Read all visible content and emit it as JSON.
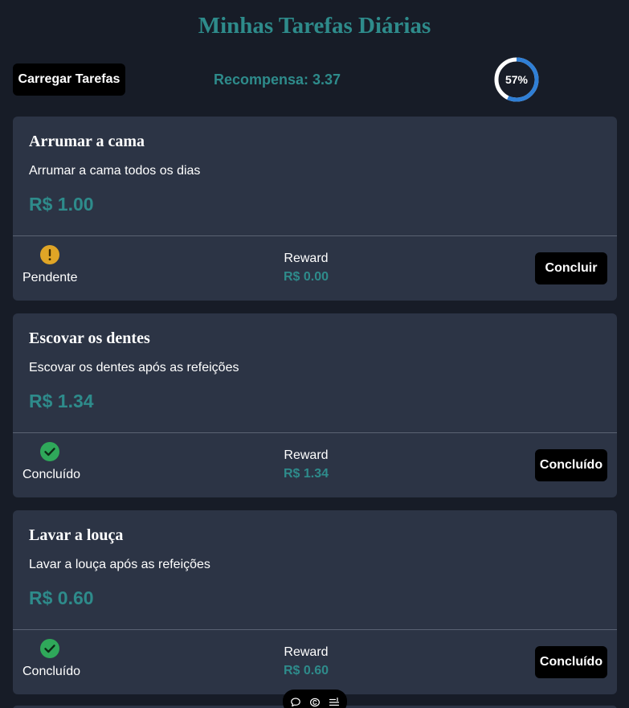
{
  "header": {
    "title": "Minhas Tarefas Diárias",
    "load_button_label": "Carregar Tarefas",
    "reward_total": "Recompensa: 3.37",
    "progress": {
      "percent": 57,
      "label": "57%"
    }
  },
  "tasks": [
    {
      "name": "Arrumar a cama",
      "description": "Arrumar a cama todos os dias",
      "amount": "R$ 1.00",
      "status_icon": "warning-icon",
      "status_label": "Pendente",
      "reward_label": "Reward",
      "reward_value": "R$ 0.00",
      "action_label": "Concluir"
    },
    {
      "name": "Escovar os dentes",
      "description": "Escovar os dentes após as refeições",
      "amount": "R$ 1.34",
      "status_icon": "check-circle-icon",
      "status_label": "Concluído",
      "reward_label": "Reward",
      "reward_value": "R$ 1.34",
      "action_label": "Concluído"
    },
    {
      "name": "Lavar a louça",
      "description": "Lavar a louça após as refeições",
      "amount": "R$ 0.60",
      "status_icon": "check-circle-icon",
      "status_label": "Concluído",
      "reward_label": "Reward",
      "reward_value": "R$ 0.60",
      "action_label": "Concluído"
    }
  ],
  "toolbar": {
    "icons": [
      "comment-icon",
      "copyright-icon",
      "list-settings-icon"
    ]
  },
  "colors": {
    "background": "#171c27",
    "card": "#2c3445",
    "accent": "#2e8b8b",
    "progress_ring": "#2f7fd6",
    "pending": "#e0a526",
    "done": "#2fa85a"
  }
}
